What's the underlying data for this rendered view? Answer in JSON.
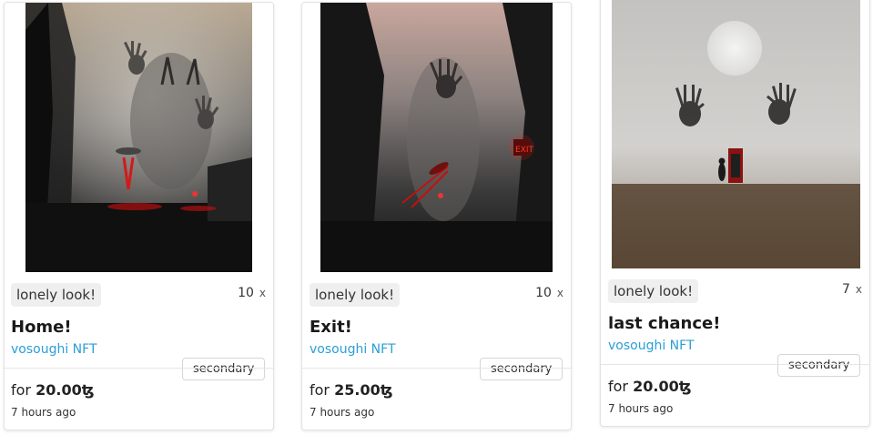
{
  "cards": [
    {
      "tag": "lonely look!",
      "count": "10",
      "count_suffix": "x",
      "title": "Home!",
      "creator": "vosoughi NFT",
      "market": "secondary",
      "price_prefix": "for",
      "price": "20.00ꜩ",
      "time": "7 hours ago",
      "image_scene": "foggy-forest-shadow-hands"
    },
    {
      "tag": "lonely look!",
      "count": "10",
      "count_suffix": "x",
      "title": "Exit!",
      "creator": "vosoughi NFT",
      "market": "secondary",
      "price_prefix": "for",
      "price": "25.00ꜩ",
      "time": "7 hours ago",
      "image_scene": "foggy-forest-exit-sign-hand"
    },
    {
      "tag": "lonely look!",
      "count": "7",
      "count_suffix": "x",
      "title": "last chance!",
      "creator": "vosoughi NFT",
      "market": "secondary",
      "price_prefix": "for",
      "price": "20.00ꜩ",
      "time": "7 hours ago",
      "image_scene": "full-moon-field-phone-booth-hands"
    }
  ],
  "colors": {
    "creator_link": "#2a9fd6",
    "tag_bg": "#efefef",
    "card_border": "#e3e3e3"
  }
}
